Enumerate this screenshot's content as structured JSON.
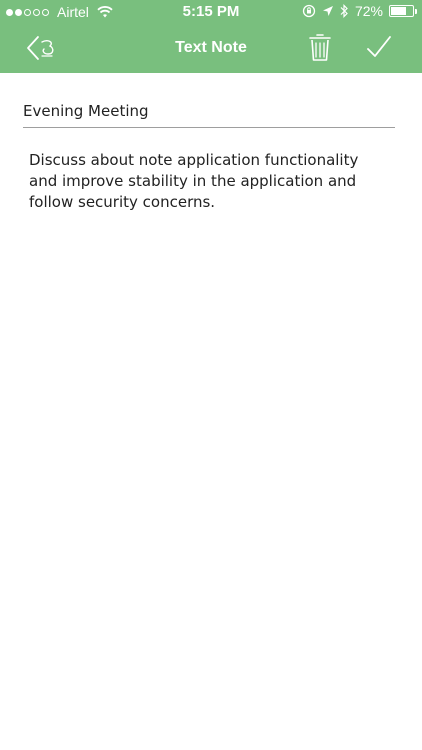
{
  "status_bar": {
    "carrier": "Airtel",
    "time": "5:15 PM",
    "battery": "72%",
    "battery_level": 0.72,
    "signal_bars_filled": 2,
    "signal_bars_total": 5
  },
  "header": {
    "title": "Text Note",
    "color": "#79bf7e",
    "icons": {
      "back": "back-chevron-icon",
      "delete": "trash-icon",
      "save": "checkmark-icon"
    }
  },
  "note": {
    "title": "Evening Meeting",
    "body": "Discuss about note application functionality and improve stability in the application and follow security concerns."
  }
}
